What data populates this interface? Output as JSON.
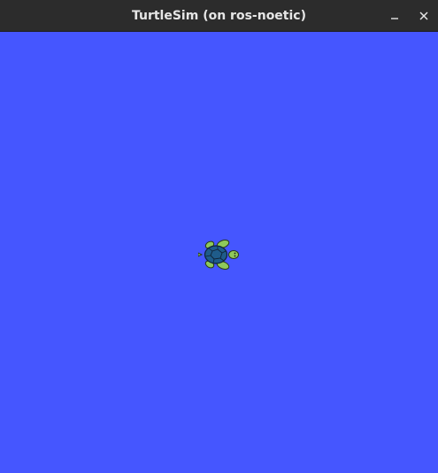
{
  "window": {
    "title": "TurtleSim (on ros-noetic)",
    "controls": {
      "minimize_icon": "minimize-icon",
      "close_icon": "close-icon"
    }
  },
  "canvas": {
    "background_color": "#4556ff"
  },
  "turtle": {
    "icon": "turtle-icon",
    "shell_color": "#1f5c8a",
    "body_color": "#8fc95a",
    "heading": "east"
  }
}
